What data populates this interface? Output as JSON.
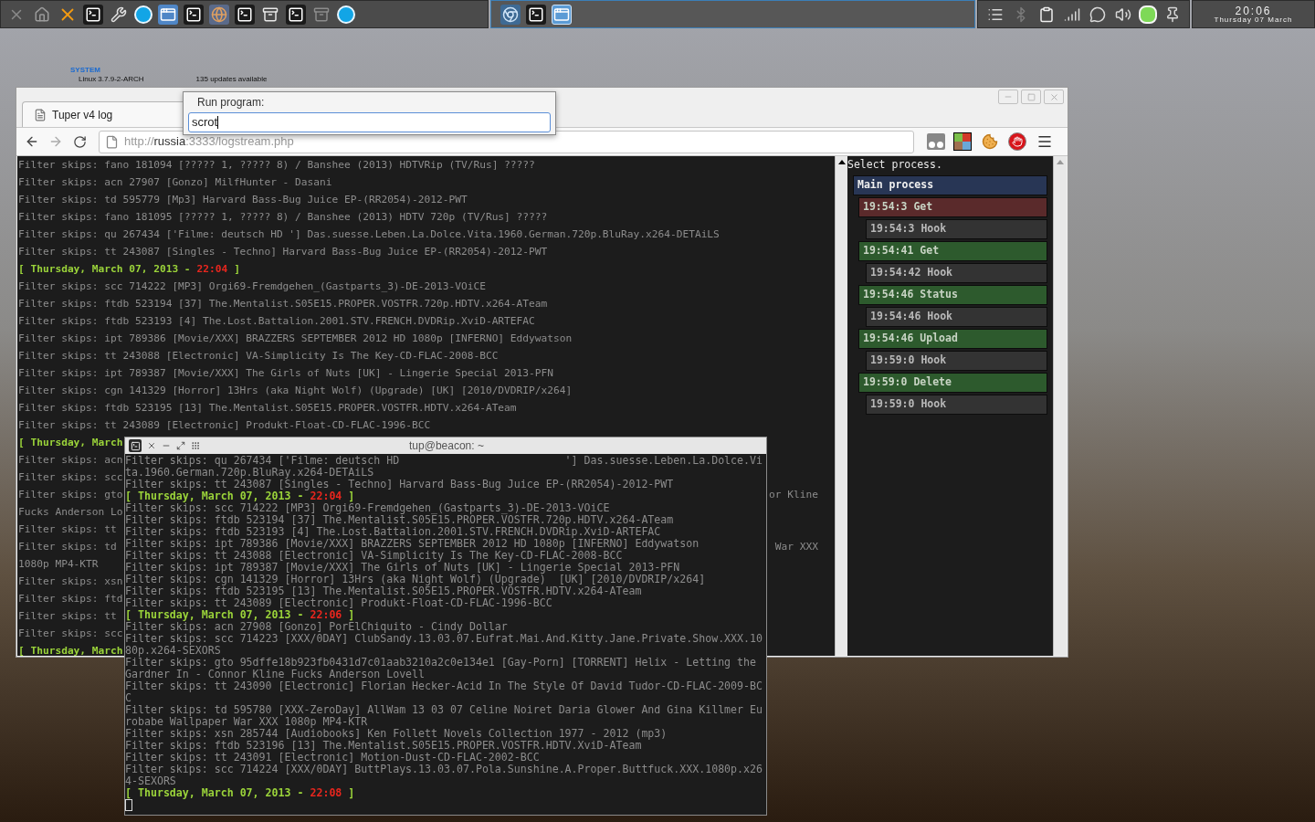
{
  "top_panel": {
    "clock": {
      "time": "20:06",
      "date": "Thursday 07 March"
    }
  },
  "desktop": {
    "conky": {
      "heading": "SYSTEM",
      "kernel": "Linux 3.7.9-2-ARCH",
      "updates": "135 updates available"
    }
  },
  "browser": {
    "tab": {
      "title": "Tuper v4 log"
    },
    "address": {
      "scheme": "http://",
      "host": "russia",
      "rest": ":3333/logstream.php"
    },
    "log": [
      {
        "kind": "log",
        "text": "Filter skips: fano 181094 [????? 1, ????? 8) / Banshee (2013) HDTVRip (TV/Rus] ?????"
      },
      {
        "kind": "log",
        "text": "Filter skips: acn 27907 [Gonzo] MilfHunter - Dasani"
      },
      {
        "kind": "log",
        "text": "Filter skips: td 595779 [Mp3] Harvard Bass-Bug Juice EP-(RR2054)-2012-PWT"
      },
      {
        "kind": "log",
        "text": "Filter skips: fano 181095 [????? 1, ????? 8) / Banshee (2013) HDTV 720p (TV/Rus] ?????"
      },
      {
        "kind": "log",
        "text": "Filter skips: qu 267434 ['Filme: deutsch HD '] Das.suesse.Leben.La.Dolce.Vita.1960.German.720p.BluRay.x264-DETAiLS"
      },
      {
        "kind": "log",
        "text": "Filter skips: tt 243087 [Singles - Techno] Harvard Bass-Bug Juice EP-(RR2054)-2012-PWT"
      },
      {
        "kind": "date",
        "text": "[ Thursday, March 07, 2013 -",
        "time": "22:04",
        "end": "]"
      },
      {
        "kind": "log",
        "text": "Filter skips: scc 714222 [MP3] Orgi69-Fremdgehen_(Gastparts_3)-DE-2013-VOiCE"
      },
      {
        "kind": "log",
        "text": "Filter skips: ftdb 523194 [37] The.Mentalist.S05E15.PROPER.VOSTFR.720p.HDTV.x264-ATeam"
      },
      {
        "kind": "log",
        "text": "Filter skips: ftdb 523193 [4] The.Lost.Battalion.2001.STV.FRENCH.DVDRip.XviD-ARTEFAC"
      },
      {
        "kind": "log",
        "text": "Filter skips: ipt 789386 [Movie/XXX] BRAZZERS SEPTEMBER 2012 HD 1080p [INFERNO] Eddywatson"
      },
      {
        "kind": "log",
        "text": "Filter skips: tt 243088 [Electronic] VA-Simplicity Is The Key-CD-FLAC-2008-BCC"
      },
      {
        "kind": "log",
        "text": "Filter skips: ipt 789387 [Movie/XXX] The Girls of Nuts [UK] - Lingerie Special 2013-PFN"
      },
      {
        "kind": "log",
        "text": "Filter skips: cgn 141329 [Horror] 13Hrs (aka Night Wolf) (Upgrade) [UK] [2010/DVDRIP/x264]"
      },
      {
        "kind": "log",
        "text": "Filter skips: ftdb 523195 [13] The.Mentalist.S05E15.PROPER.VOSTFR.HDTV.x264-ATeam"
      },
      {
        "kind": "log",
        "text": "Filter skips: tt 243089 [Electronic] Produkt-Float-CD-FLAC-1996-BCC"
      },
      {
        "kind": "date",
        "text": "[ Thursday, March"
      },
      {
        "kind": "log",
        "text": "Filter skips: acn"
      },
      {
        "kind": "log",
        "text": "Filter skips: scc"
      },
      {
        "kind": "log",
        "text": "Filter skips: gto",
        "tail": "or Kline"
      },
      {
        "kind": "log",
        "text": "Fucks Anderson Lo"
      },
      {
        "kind": "log",
        "text": "Filter skips: tt"
      },
      {
        "kind": "log",
        "text": "Filter skips: td",
        "tail": "War XXX"
      },
      {
        "kind": "log",
        "text": "1080p MP4-KTR"
      },
      {
        "kind": "log",
        "text": "Filter skips: xsn"
      },
      {
        "kind": "log",
        "text": "Filter skips: ftd"
      },
      {
        "kind": "log",
        "text": "Filter skips: tt"
      },
      {
        "kind": "log",
        "text": "Filter skips: scc"
      },
      {
        "kind": "date",
        "text": "[ Thursday, March"
      }
    ],
    "process_panel": {
      "heading": "Select process.",
      "tree": [
        {
          "kind": "group",
          "label": "Main process",
          "children": [
            {
              "kind": "event",
              "color": "#5a2a2b",
              "label": "19:54:3 Get",
              "children": [
                {
                  "kind": "hook",
                  "label": "19:54:3 Hook"
                }
              ]
            },
            {
              "kind": "event",
              "color": "#2d5a2d",
              "label": "19:54:41 Get",
              "children": [
                {
                  "kind": "hook",
                  "label": "19:54:42 Hook"
                }
              ]
            },
            {
              "kind": "event",
              "color": "#2d5a2d",
              "label": "19:54:46 Status",
              "children": [
                {
                  "kind": "hook",
                  "label": "19:54:46 Hook"
                }
              ]
            },
            {
              "kind": "event",
              "color": "#2d5a2d",
              "label": "19:54:46 Upload",
              "children": [
                {
                  "kind": "hook",
                  "label": "19:59:0 Hook"
                }
              ]
            },
            {
              "kind": "event",
              "color": "#2d5a2d",
              "label": "19:59:0 Delete",
              "children": [
                {
                  "kind": "hook",
                  "label": "19:59:0 Hook"
                }
              ]
            }
          ]
        }
      ]
    }
  },
  "run_dialog": {
    "label": "Run program:",
    "value": "scrot"
  },
  "terminal": {
    "title": "tup@beacon: ~",
    "lines": [
      {
        "kind": "log",
        "text": "Filter skips: qu 267434 ['Filme: deutsch HD                          '] Das.suesse.Leben.La.Dolce.Vi"
      },
      {
        "kind": "log",
        "text": "ta.1960.German.720p.BluRay.x264-DETAiLS"
      },
      {
        "kind": "log",
        "text": "Filter skips: tt 243087 [Singles - Techno] Harvard Bass-Bug Juice EP-(RR2054)-2012-PWT"
      },
      {
        "kind": "date",
        "text": "[ Thursday, March 07, 2013 -",
        "time": "22:04",
        "end": "]"
      },
      {
        "kind": "log",
        "text": "Filter skips: scc 714222 [MP3] Orgi69-Fremdgehen_(Gastparts_3)-DE-2013-VOiCE"
      },
      {
        "kind": "log",
        "text": "Filter skips: ftdb 523194 [37] The.Mentalist.S05E15.PROPER.VOSTFR.720p.HDTV.x264-ATeam"
      },
      {
        "kind": "log",
        "text": "Filter skips: ftdb 523193 [4] The.Lost.Battalion.2001.STV.FRENCH.DVDRip.XviD-ARTEFAC"
      },
      {
        "kind": "log",
        "text": "Filter skips: ipt 789386 [Movie/XXX] BRAZZERS SEPTEMBER 2012 HD 1080p [INFERNO] Eddywatson"
      },
      {
        "kind": "log",
        "text": "Filter skips: tt 243088 [Electronic] VA-Simplicity Is The Key-CD-FLAC-2008-BCC"
      },
      {
        "kind": "log",
        "text": "Filter skips: ipt 789387 [Movie/XXX] The Girls of Nuts [UK] - Lingerie Special 2013-PFN"
      },
      {
        "kind": "log",
        "text": "Filter skips: cgn 141329 [Horror] 13Hrs (aka Night Wolf) (Upgrade)  [UK] [2010/DVDRIP/x264]"
      },
      {
        "kind": "log",
        "text": "Filter skips: ftdb 523195 [13] The.Mentalist.S05E15.PROPER.VOSTFR.HDTV.x264-ATeam"
      },
      {
        "kind": "log",
        "text": "Filter skips: tt 243089 [Electronic] Produkt-Float-CD-FLAC-1996-BCC"
      },
      {
        "kind": "date",
        "text": "[ Thursday, March 07, 2013 -",
        "time": "22:06",
        "end": "]"
      },
      {
        "kind": "log",
        "text": "Filter skips: acn 27908 [Gonzo] PorElChiquito - Cindy Dollar"
      },
      {
        "kind": "log",
        "text": "Filter skips: scc 714223 [XXX/0DAY] ClubSandy.13.03.07.Eufrat.Mai.And.Kitty.Jane.Private.Show.XXX.10"
      },
      {
        "kind": "log",
        "text": "80p.x264-SEXORS"
      },
      {
        "kind": "log",
        "text": "Filter skips: gto 95dffe18b923fb0431d7c01aab3210a2c0e134e1 [Gay-Porn] [TORRENT] Helix - Letting the"
      },
      {
        "kind": "log",
        "text": "Gardner In - Connor Kline Fucks Anderson Lovell"
      },
      {
        "kind": "log",
        "text": "Filter skips: tt 243090 [Electronic] Florian Hecker-Acid In The Style Of David Tudor-CD-FLAC-2009-BC"
      },
      {
        "kind": "log",
        "text": "C"
      },
      {
        "kind": "log",
        "text": "Filter skips: td 595780 [XXX-ZeroDay] AllWam 13 03 07 Celine Noiret Daria Glower And Gina Killmer Eu"
      },
      {
        "kind": "log",
        "text": "robabe Wallpaper War XXX 1080p MP4-KTR"
      },
      {
        "kind": "log",
        "text": "Filter skips: xsn 285744 [Audiobooks] Ken Follett Novels Collection 1977 - 2012 (mp3)"
      },
      {
        "kind": "log",
        "text": "Filter skips: ftdb 523196 [13] The.Mentalist.S05E15.PROPER.VOSTFR.HDTV.XviD-ATeam"
      },
      {
        "kind": "log",
        "text": "Filter skips: tt 243091 [Electronic] Motion-Dust-CD-FLAC-2002-BCC"
      },
      {
        "kind": "log",
        "text": "Filter skips: scc 714224 [XXX/0DAY] ButtPlays.13.03.07.Pola.Sunshine.A.Proper.Buttfuck.XXX.1080p.x26"
      },
      {
        "kind": "log",
        "text": "4-SEXORS"
      },
      {
        "kind": "date",
        "text": "[ Thursday, March 07, 2013 -",
        "time": "22:08",
        "end": "]"
      }
    ]
  }
}
